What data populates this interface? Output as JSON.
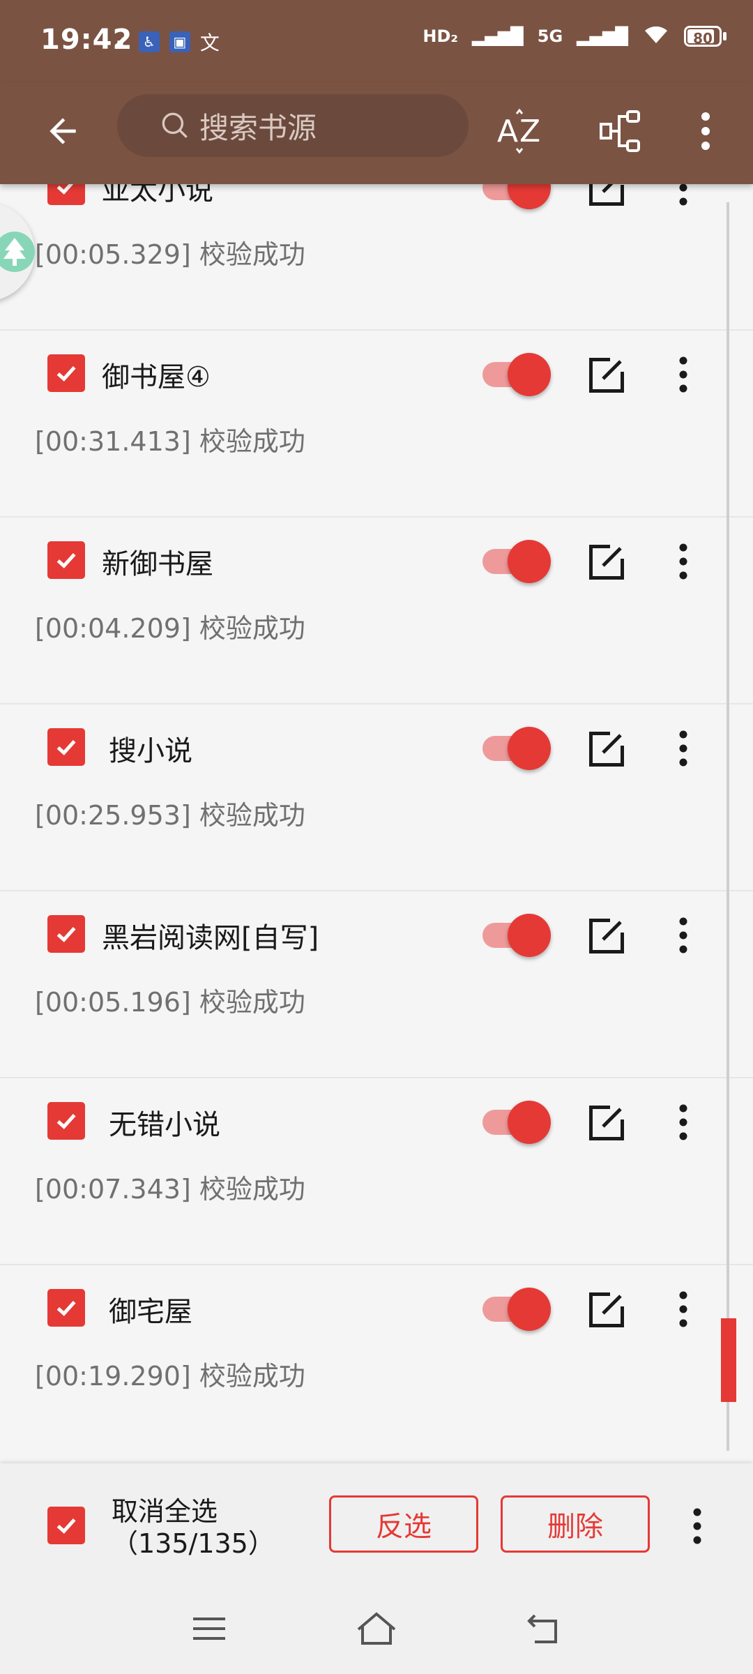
{
  "status_bar": {
    "time": "19:42",
    "battery": "80",
    "network_label": "5G"
  },
  "app_bar": {
    "search_placeholder": "搜索书源"
  },
  "sources": [
    {
      "name": "亚太小说",
      "status": "[00:05.329] 校验成功",
      "checked": true,
      "enabled": true
    },
    {
      "name": "御书屋④",
      "status": "[00:31.413] 校验成功",
      "checked": true,
      "enabled": true
    },
    {
      "name": "新御书屋",
      "status": "[00:04.209] 校验成功",
      "checked": true,
      "enabled": true
    },
    {
      "name": "搜小说",
      "status": "[00:25.953] 校验成功",
      "checked": true,
      "enabled": true
    },
    {
      "name": "黑岩阅读网[自写]",
      "status": "[00:05.196] 校验成功",
      "checked": true,
      "enabled": true
    },
    {
      "name": "无错小说",
      "status": "[00:07.343] 校验成功",
      "checked": true,
      "enabled": true
    },
    {
      "name": "御宅屋",
      "status": "[00:19.290] 校验成功",
      "checked": true,
      "enabled": true
    }
  ],
  "bottom_bar": {
    "select_all_label": "取消全选",
    "count_label": "（135/135）",
    "invert_label": "反选",
    "delete_label": "删除"
  },
  "colors": {
    "primary": "#7b5343",
    "accent": "#e53935",
    "accent_light": "#ef9a9a"
  }
}
